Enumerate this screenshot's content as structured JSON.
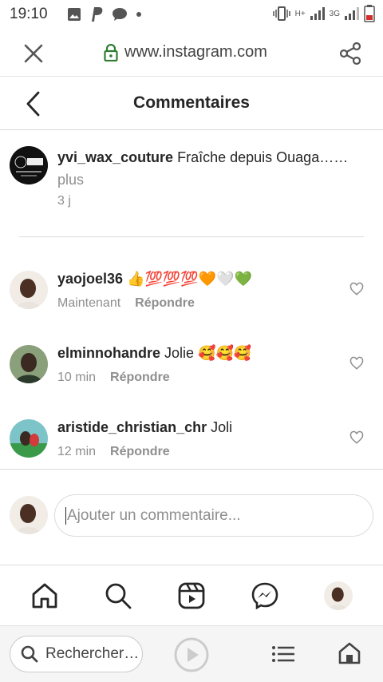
{
  "status_bar": {
    "time": "19:10",
    "network_label": "3G",
    "network_label_2": "H+"
  },
  "browser": {
    "url": "www.instagram.com",
    "close_icon": "close-icon",
    "lock_icon": "lock-icon",
    "share_icon": "share-icon"
  },
  "header": {
    "title": "Commentaires",
    "back_icon": "chevron-left-icon"
  },
  "caption": {
    "username": "yvi_wax_couture",
    "text": "Fraîche depuis Ouaga……",
    "more": "plus",
    "time": "3 j"
  },
  "comments": [
    {
      "username": "yaojoel36",
      "text": "👍💯💯💯🧡🤍💚",
      "time": "Maintenant",
      "reply": "Répondre"
    },
    {
      "username": "elminnohandre",
      "text": "Jolie 🥰🥰🥰",
      "time": "10 min",
      "reply": "Répondre"
    },
    {
      "username": "aristide_christian_chr",
      "text": "Joli",
      "time": "12 min",
      "reply": "Répondre"
    }
  ],
  "add_comment": {
    "placeholder": "Ajouter un commentaire..."
  },
  "ig_nav": {
    "items": [
      "home-icon",
      "search-icon",
      "reels-icon",
      "messenger-icon",
      "profile-avatar"
    ]
  },
  "browser_bottom": {
    "search_label": "Rechercher…",
    "items": [
      "search-icon",
      "play-icon",
      "list-icon",
      "home-icon"
    ]
  },
  "colors": {
    "secure_green": "#2e7d32",
    "text": "#262626",
    "secondary_text": "#8e8e8e",
    "divider": "#dbdbdb"
  }
}
